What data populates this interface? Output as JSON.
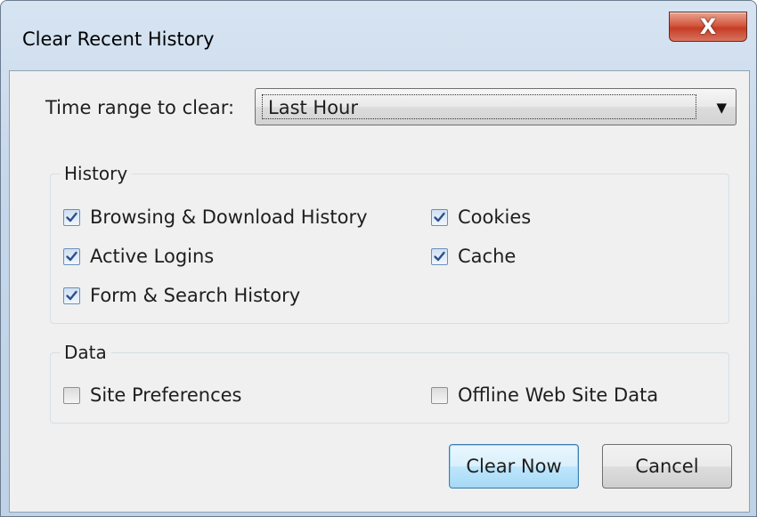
{
  "window": {
    "title": "Clear Recent History",
    "close_glyph": "X"
  },
  "time_range": {
    "label": "Time range to clear:",
    "value": "Last Hour",
    "arrow_icon": "dropdown-arrow-icon"
  },
  "history": {
    "legend": "History",
    "items": [
      {
        "label": "Browsing & Download History",
        "checked": true
      },
      {
        "label": "Cookies",
        "checked": true
      },
      {
        "label": "Active Logins",
        "checked": true
      },
      {
        "label": "Cache",
        "checked": true
      },
      {
        "label": "Form & Search History",
        "checked": true
      }
    ]
  },
  "data": {
    "legend": "Data",
    "items": [
      {
        "label": "Site Preferences",
        "checked": false
      },
      {
        "label": "Offline Web Site Data",
        "checked": false
      }
    ]
  },
  "buttons": {
    "clear_now": "Clear Now",
    "cancel": "Cancel"
  },
  "colors": {
    "accent": "#3c7fb1",
    "close_button": "#c53d26",
    "window_frame": "#c6d7ea",
    "client_background": "#f0f0f0"
  }
}
